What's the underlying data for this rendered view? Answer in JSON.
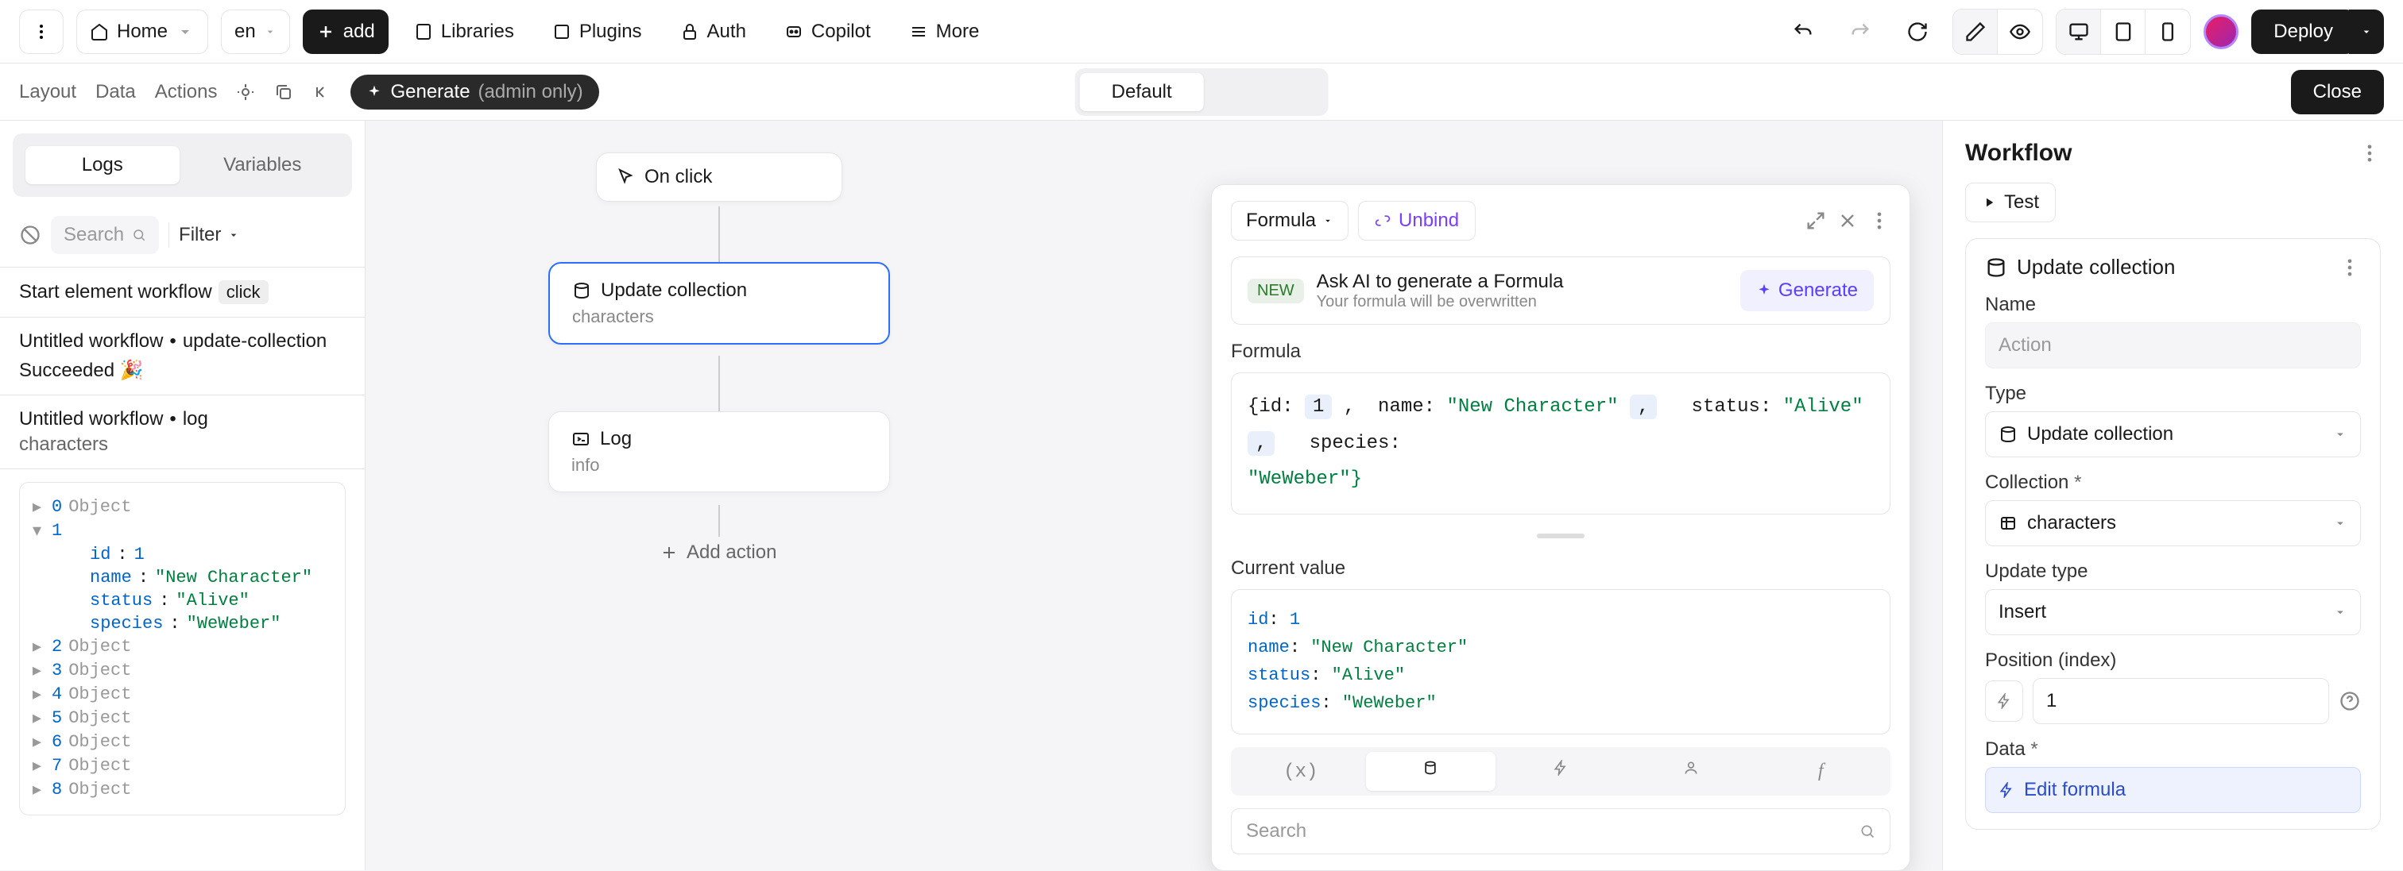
{
  "toolbar": {
    "home": "Home",
    "lang": "en",
    "add": "add",
    "libraries": "Libraries",
    "plugins": "Plugins",
    "auth": "Auth",
    "copilot": "Copilot",
    "more": "More",
    "deploy": "Deploy"
  },
  "secondBar": {
    "tabs": [
      "Layout",
      "Data",
      "Actions"
    ],
    "chip_label": "Generate",
    "chip_suffix": "(admin only)",
    "segment_default": "Default",
    "close": "Close"
  },
  "leftPanel": {
    "tab_logs": "Logs",
    "tab_variables": "Variables",
    "search_placeholder": "Search",
    "filter": "Filter",
    "section0": {
      "prefix": "Start element workflow",
      "pill": "click"
    },
    "section1": {
      "title_a": "Untitled workflow",
      "title_b": "update-collection",
      "status": "Succeeded 🎉"
    },
    "section2": {
      "title_a": "Untitled workflow",
      "title_b": "log",
      "sub": "characters"
    },
    "tree": {
      "rows": [
        {
          "k": "0",
          "t": "Object"
        },
        {
          "k": "1",
          "t": ""
        },
        {
          "k": "id",
          "v": "1"
        },
        {
          "k": "name",
          "v": "\"New Character\""
        },
        {
          "k": "status",
          "v": "\"Alive\""
        },
        {
          "k": "species",
          "v": "\"WeWeber\""
        },
        {
          "k": "2",
          "t": "Object"
        },
        {
          "k": "3",
          "t": "Object"
        },
        {
          "k": "4",
          "t": "Object"
        },
        {
          "k": "5",
          "t": "Object"
        },
        {
          "k": "6",
          "t": "Object"
        },
        {
          "k": "7",
          "t": "Object"
        },
        {
          "k": "8",
          "t": "Object"
        }
      ]
    }
  },
  "canvas": {
    "node_onclick": "On click",
    "node_update_title": "Update collection",
    "node_update_sub": "characters",
    "node_log_title": "Log",
    "node_log_sub": "info",
    "add_action": "Add action"
  },
  "popup": {
    "formula_label": "Formula",
    "unbind": "Unbind",
    "new_badge": "NEW",
    "ai_title": "Ask AI to generate a Formula",
    "ai_sub": "Your formula will be overwritten",
    "generate": "Generate",
    "section_formula": "Formula",
    "editor": {
      "id_label": "{id:",
      "id_val": "1",
      "name_label": "name:",
      "name_val": "\"New Character\"",
      "status_label": "status:",
      "status_val": "\"Alive\"",
      "species_label": "species:",
      "species_val": "\"WeWeber\"}"
    },
    "current_value": "Current value",
    "cv": {
      "l1a": "id",
      "l1b": ": ",
      "l1c": "1",
      "l2a": "name",
      "l2b": ": ",
      "l2c": "\"New Character\"",
      "l3a": "status",
      "l3b": ": ",
      "l3c": "\"Alive\"",
      "l4a": "species",
      "l4b": ": ",
      "l4c": "\"WeWeber\""
    },
    "search_placeholder": "Search"
  },
  "rightPanel": {
    "title": "Workflow",
    "test": "Test",
    "card_title": "Update collection",
    "name_label": "Name",
    "name_placeholder": "Action",
    "type_label": "Type",
    "type_value": "Update collection",
    "collection_label": "Collection",
    "collection_value": "characters",
    "update_type_label": "Update type",
    "update_type_value": "Insert",
    "position_label": "Position (index)",
    "position_value": "1",
    "data_label": "Data",
    "edit_formula": "Edit formula",
    "asterisk": "*"
  },
  "chart_data": null
}
